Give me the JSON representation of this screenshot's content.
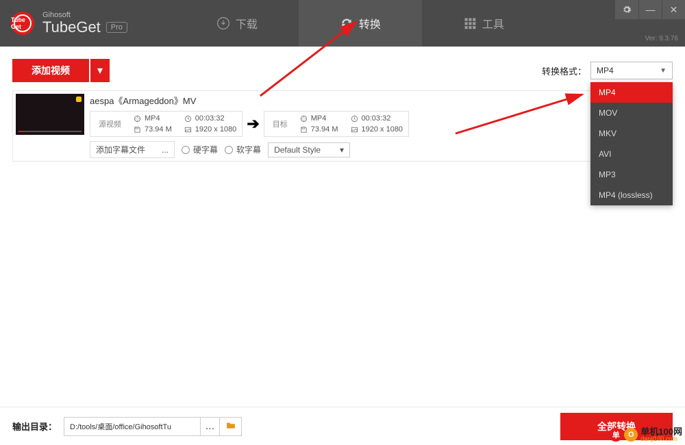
{
  "brand": {
    "small": "Gihosoft",
    "name": "TubeGet",
    "badge": "Pro",
    "logo": "Tube\nGet"
  },
  "version": "Ver: 9.3.76",
  "tabs": {
    "download": "下载",
    "convert": "转换",
    "tools": "工具"
  },
  "toolbar": {
    "add": "添加视频",
    "format_label": "转换格式：",
    "format_value": "MP4"
  },
  "dropdown": [
    "MP4",
    "MOV",
    "MKV",
    "AVI",
    "MP3",
    "MP4 (lossless)"
  ],
  "dropdown_selected": 0,
  "item": {
    "title": "aespa《Armageddon》MV",
    "source_label": "源视频",
    "target_label": "目标",
    "source": {
      "format": "MP4",
      "duration": "00:03:32",
      "size": "73.94 M",
      "res": "1920 x 1080"
    },
    "target": {
      "format": "MP4",
      "duration": "00:03:32",
      "size": "73.94 M",
      "res": "1920 x 1080"
    },
    "subtitle_add": "添加字幕文件",
    "subtitle_more": "...",
    "hard_sub": "硬字幕",
    "soft_sub": "软字幕",
    "default_style": "Default Style"
  },
  "footer": {
    "label": "输出目录：",
    "path": "D:/tools/桌面/office/GihosoftTu",
    "more": "...",
    "convert_all": "全部转换"
  },
  "watermark": {
    "zh": "单机100网",
    "url": "danji100.com"
  }
}
